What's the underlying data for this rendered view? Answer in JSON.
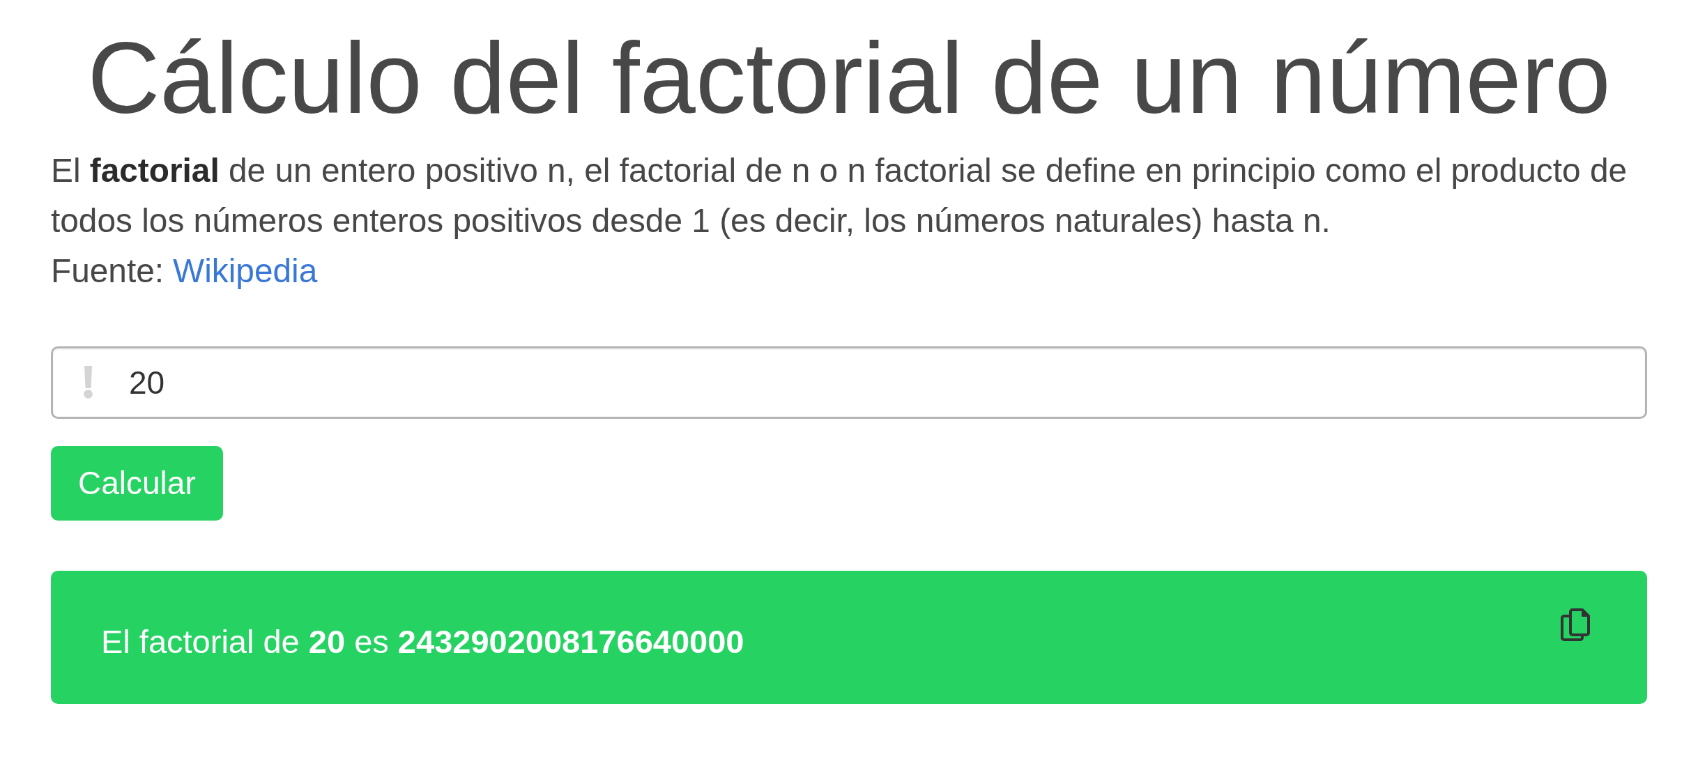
{
  "title": "Cálculo del factorial de un número",
  "description": {
    "text": "El **factorial** de un entero positivo n, el factorial de n o n factorial se define en principio como el producto de todos los números enteros positivos desde 1 (es decir, los números naturales) hasta n.",
    "source_label": "Fuente:",
    "source_link": "Wikipedia"
  },
  "input": {
    "value": "20"
  },
  "button": {
    "label": "Calcular"
  },
  "result": {
    "text": "El factorial de **20** es **2432902008176640000**"
  }
}
